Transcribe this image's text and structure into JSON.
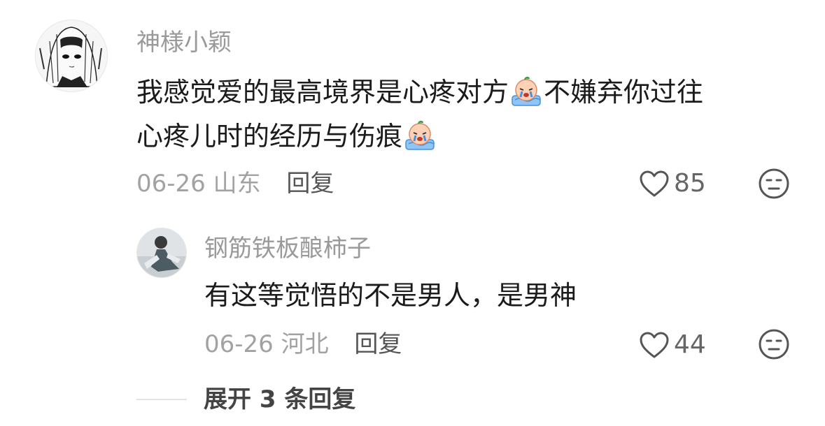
{
  "comments": [
    {
      "username": "神様小颖",
      "text_line1_a": "我感觉爱的最高境界是心疼对方",
      "text_line1_b": "不嫌弃你过往",
      "text_line2": "心疼儿时的经历与伤痕",
      "date": "06-26",
      "location": "山东",
      "reply_label": "回复",
      "likes": "85",
      "emoji": "crying-face-icon"
    }
  ],
  "replies": [
    {
      "username": "钢筋铁板酿柿子",
      "text": "有这等觉悟的不是男人，是男神",
      "date": "06-26",
      "location": "河北",
      "reply_label": "回复",
      "likes": "44"
    }
  ],
  "expand": {
    "label": "展开 3 条回复"
  },
  "colors": {
    "username": "#9a9a9a",
    "text": "#1b1b1b",
    "meta": "#a2a2a2",
    "icon": "#666666"
  }
}
